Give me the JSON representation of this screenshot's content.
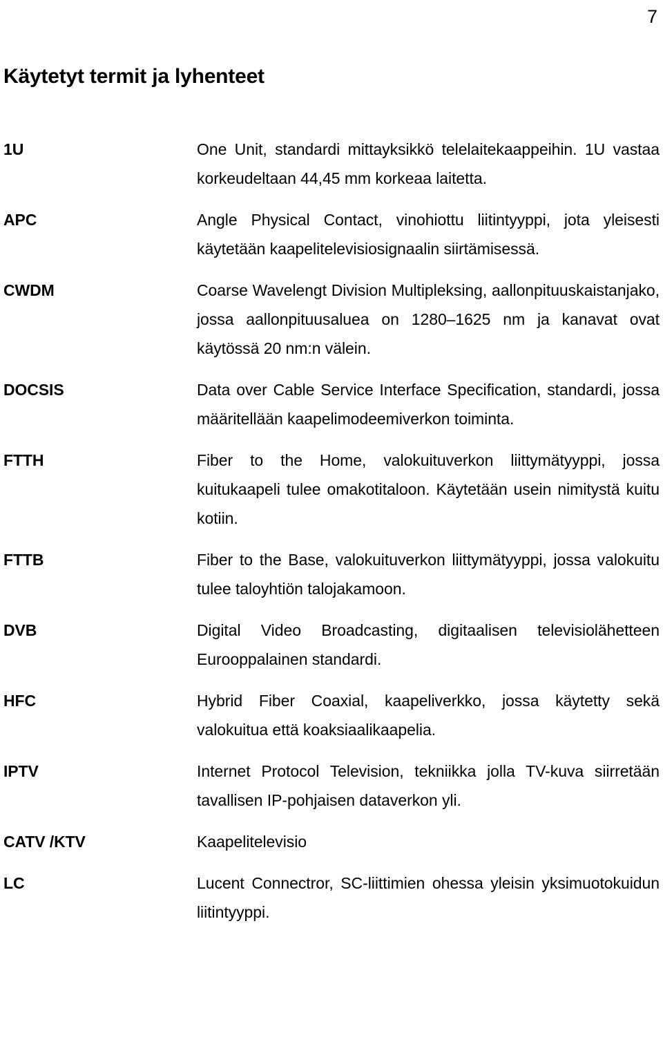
{
  "page": {
    "number": "7",
    "title": "Käytetyt termit ja lyhenteet"
  },
  "glossary": {
    "entries": [
      {
        "term": "1U",
        "definition": "One Unit, standardi mittayksikkö telelaitekaappeihin. 1U vastaa korkeudeltaan 44,45 mm korkeaa laitetta."
      },
      {
        "term": "APC",
        "definition": "Angle Physical Contact, vinohiottu liitintyyppi, jota yleisesti käytetään kaapelitelevisiosignaalin siirtämisessä."
      },
      {
        "term": "CWDM",
        "definition": "Coarse Wavelengt Division Multipleksing, aallonpituuskaistanjako, jossa aallonpituusaluea on 1280–1625 nm ja kanavat ovat käytössä 20 nm:n välein."
      },
      {
        "term": "DOCSIS",
        "definition": "Data over Cable Service Interface Specification, standardi, jossa määritellään kaapelimodeemiverkon toiminta."
      },
      {
        "term": "FTTH",
        "definition": "Fiber to the Home, valokuituverkon liittymätyyppi, jossa kuitukaapeli tulee omakotitaloon. Käytetään usein nimitystä kuitu kotiin."
      },
      {
        "term": "FTTB",
        "definition": "Fiber to the Base, valokuituverkon liittymätyyppi, jossa valokuitu tulee taloyhtiön talojakamoon."
      },
      {
        "term": "DVB",
        "definition": "Digital Video Broadcasting, digitaalisen televisiolähetteen Eurooppalainen standardi."
      },
      {
        "term": "HFC",
        "definition": "Hybrid Fiber Coaxial, kaapeliverkko, jossa käytetty sekä valokuitua että koaksiaalikaapelia."
      },
      {
        "term": "IPTV",
        "definition": "Internet Protocol Television, tekniikka jolla TV-kuva siirretään tavallisen IP-pohjaisen dataverkon yli."
      },
      {
        "term": "CATV /KTV",
        "definition": "Kaapelitelevisio"
      },
      {
        "term": "LC",
        "definition": "Lucent Connectror, SC-liittimien ohessa yleisin yksimuotokuidun liitintyyppi."
      }
    ]
  }
}
